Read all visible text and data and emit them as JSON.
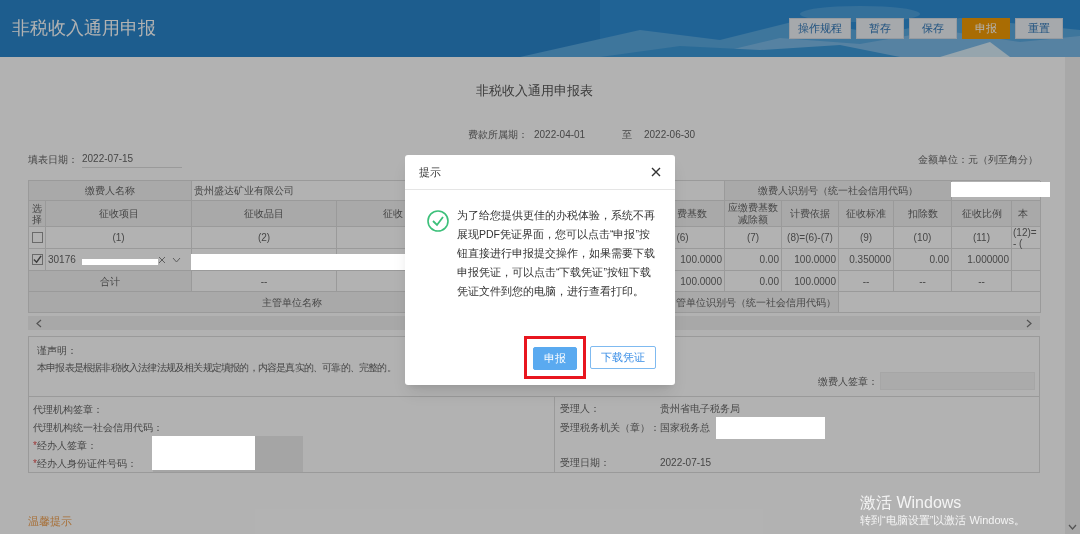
{
  "header": {
    "title": "非税收入通用申报",
    "buttons": [
      {
        "label": "操作规程",
        "kind": "default"
      },
      {
        "label": "暂存",
        "kind": "default"
      },
      {
        "label": "保存",
        "kind": "default"
      },
      {
        "label": "申报",
        "kind": "primary"
      },
      {
        "label": "重置",
        "kind": "default"
      }
    ]
  },
  "form": {
    "title": "非税收入通用申报表",
    "period_label": "费款所属期：",
    "period_start": "2022-04-01",
    "period_to": "至",
    "period_end": "2022-06-30",
    "fill_date_label": "填表日期：",
    "fill_date": "2022-07-15",
    "unit_note": "金额单位：元（列至角分）"
  },
  "table": {
    "payer_name_label": "缴费人名称",
    "payer_name": "贵州盛达矿业有限公司",
    "payer_id_label": "缴费人识别号（统一社会信用代码）",
    "select_header": "选择",
    "select_all_checked": false,
    "left_columns": [
      {
        "header": "征收项目",
        "number": "(1)"
      },
      {
        "header": "征收品目",
        "number": "(2)"
      },
      {
        "header": "征收"
      }
    ],
    "right_columns": [
      {
        "header": "费基数",
        "number": "(6)"
      },
      {
        "header": "应缴费基数减除额",
        "number": "(7)"
      },
      {
        "header": "计费依据",
        "number": "(8)=(6)-(7)"
      },
      {
        "header": "征收标准",
        "number": "(9)"
      },
      {
        "header": "扣除数",
        "number": "(10)"
      },
      {
        "header": "征收比例",
        "number": "(11)"
      },
      {
        "header": "本",
        "number": "(12)= - ("
      }
    ],
    "row": {
      "checked": true,
      "item": "30176",
      "values": [
        "100.0000",
        "0.00",
        "100.0000",
        "0.350000",
        "0.00",
        "1.000000"
      ]
    },
    "total": {
      "label": "合计",
      "item_value": "--",
      "values": [
        "100.0000",
        "0.00",
        "100.0000",
        "--",
        "--",
        "--"
      ]
    },
    "authority": {
      "name_label": "主管单位名称",
      "id_label": "管单位识别号（统一社会信用代码）"
    }
  },
  "declaration": {
    "title": "谨声明：",
    "text": "本申报表是根据非税收入法律法规及相关规定填报的，内容是真实的、可靠的、完整的。",
    "payer_sign_label": "缴费人签章："
  },
  "agent_fields": [
    {
      "label": "代理机构签章：",
      "has_field": false
    },
    {
      "label": "代理机构统一社会信用代码：",
      "has_field": false
    },
    {
      "label": "经办人签章：",
      "mark": "*",
      "has_field": true
    },
    {
      "label": "经办人身份证件号码：",
      "mark": "*",
      "has_field": true
    }
  ],
  "acceptance": [
    {
      "label": "受理人：",
      "value": "贵州省电子税务局"
    },
    {
      "label": "受理税务机关（章）：",
      "value": "国家税务总"
    },
    {
      "label": "受理日期：",
      "value": "2022-07-15"
    }
  ],
  "tip": "温馨提示",
  "dialog": {
    "title": "提示",
    "message": "为了给您提供更佳的办税体验，系统不再展现PDF凭证界面，您可以点击“申报”按钮直接进行申报提交操作，如果需要下载申报凭证，可以点击“下载凭证”按钮下载凭证文件到您的电脑，进行查看打印。",
    "buttons": [
      {
        "label": "申报",
        "kind": "primary",
        "highlighted": true
      },
      {
        "label": "下载凭证",
        "kind": "outline",
        "highlighted": false
      }
    ]
  },
  "os_notice": {
    "title": "激活 Windows",
    "subtitle": "转到“电脑设置”以激活 Windows。"
  }
}
